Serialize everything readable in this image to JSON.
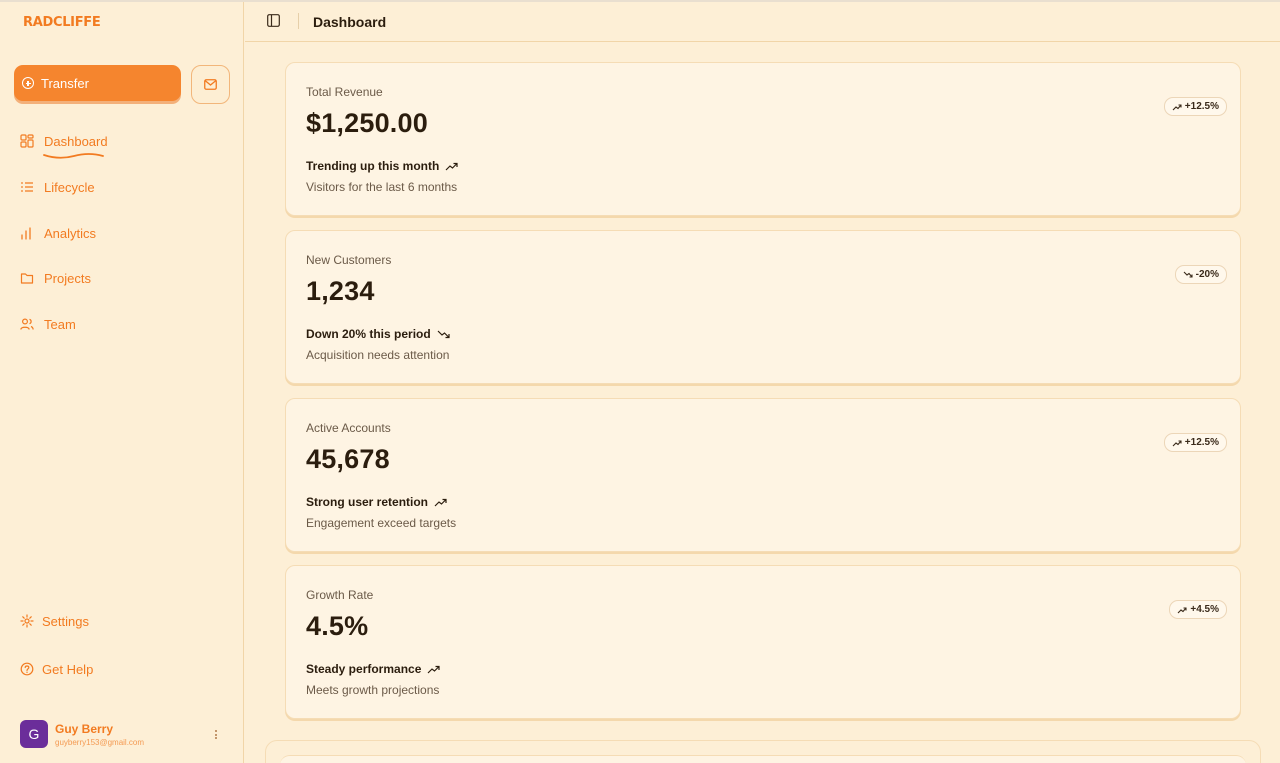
{
  "app": {
    "brand": "RADCLIFFE"
  },
  "sidebar": {
    "transfer_label": "Transfer",
    "mail_icon": "mail-icon",
    "nav": [
      {
        "label": "Dashboard",
        "icon": "dashboard-icon",
        "active": true
      },
      {
        "label": "Lifecycle",
        "icon": "list-icon"
      },
      {
        "label": "Analytics",
        "icon": "bar-chart-icon"
      },
      {
        "label": "Projects",
        "icon": "folder-icon"
      },
      {
        "label": "Team",
        "icon": "users-icon"
      }
    ],
    "bottom_nav": [
      {
        "label": "Settings",
        "icon": "gear-icon"
      },
      {
        "label": "Get Help",
        "icon": "help-icon"
      }
    ],
    "user": {
      "initial": "G",
      "name": "Guy Berry",
      "email": "guyberry153@gmail.com"
    }
  },
  "header": {
    "title": "Dashboard"
  },
  "cards": [
    {
      "label": "Total Revenue",
      "value": "$1,250.00",
      "badge": "+12.5%",
      "direction": "up",
      "trend": "Trending up this month",
      "sub": "Visitors for the last 6 months"
    },
    {
      "label": "New Customers",
      "value": "1,234",
      "badge": "-20%",
      "direction": "down",
      "trend": "Down 20% this period",
      "sub": "Acquisition needs attention"
    },
    {
      "label": "Active Accounts",
      "value": "45,678",
      "badge": "+12.5%",
      "direction": "up",
      "trend": "Strong user retention",
      "sub": "Engagement exceed targets"
    },
    {
      "label": "Growth Rate",
      "value": "4.5%",
      "badge": "+4.5%",
      "direction": "up",
      "trend": "Steady performance",
      "sub": "Meets growth projections"
    }
  ],
  "colors": {
    "accent": "#f27b21",
    "background": "#fdefd6",
    "card": "#fef4e3",
    "avatar": "#6b2d9a"
  }
}
